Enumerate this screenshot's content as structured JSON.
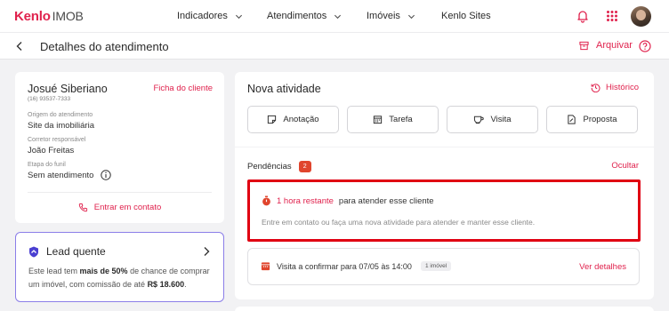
{
  "brand": {
    "logo_main": "Kenlo",
    "logo_sub": "IMOB",
    "accent": "#e0224d"
  },
  "nav": {
    "items": [
      {
        "label": "Indicadores"
      },
      {
        "label": "Atendimentos"
      },
      {
        "label": "Imóveis"
      },
      {
        "label": "Kenlo Sites"
      }
    ]
  },
  "subheader": {
    "title": "Detalhes do atendimento",
    "archive_label": "Arquivar"
  },
  "client": {
    "name": "Josué Siberiano",
    "phone": "(16) 93537-7333",
    "link_label": "Ficha do cliente",
    "fields": [
      {
        "label": "Origem do atendimento",
        "value": "Site da imobiliária"
      },
      {
        "label": "Corretor responsável",
        "value": "João Freitas"
      },
      {
        "label": "Etapa do funil",
        "value": "Sem atendimento"
      }
    ],
    "contact_label": "Entrar em contato"
  },
  "lead": {
    "title": "Lead quente",
    "text_1": "Este lead tem ",
    "text_bold_1": "mais de 50%",
    "text_2": " de chance de comprar um imóvel, com comissão de até ",
    "text_bold_2": "R$ 18.600",
    "text_3": "."
  },
  "activity": {
    "title": "Nova atividade",
    "history_label": "Histórico",
    "buttons": [
      {
        "label": "Anotação",
        "icon": "note-icon"
      },
      {
        "label": "Tarefa",
        "icon": "calendar-icon"
      },
      {
        "label": "Visita",
        "icon": "coffee-icon"
      },
      {
        "label": "Proposta",
        "icon": "document-icon"
      }
    ]
  },
  "pendencias": {
    "title": "Pendências",
    "count": "2",
    "hide_label": "Ocultar",
    "alert": {
      "highlight": "1 hora restante",
      "text": "para atender esse cliente",
      "subtext": "Entre em contato ou faça uma nova atividade para atender e manter esse cliente."
    },
    "visit": {
      "text": "Visita a confirmar para 07/05 às 14:00",
      "chip": "1 imóvel",
      "link_label": "Ver detalhes"
    }
  }
}
